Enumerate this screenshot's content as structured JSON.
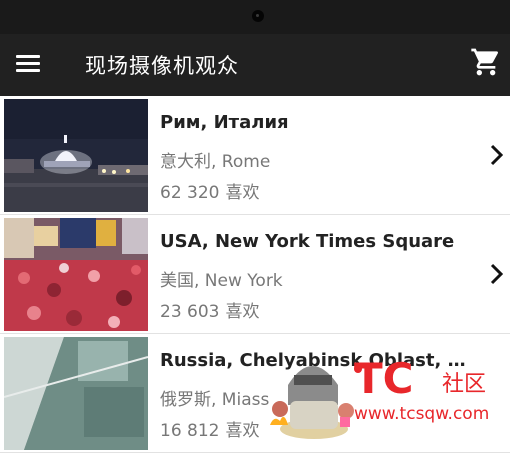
{
  "app_bar": {
    "title": "现场摄像机观众"
  },
  "icons": {
    "menu": "hamburger-menu-icon",
    "cart": "shopping-cart-icon",
    "chevron": "chevron-right-icon"
  },
  "webcams": [
    {
      "title": "Рим, Италия",
      "subtitle": "意大利, Rome",
      "likes": "62 320",
      "likes_label": "喜欢"
    },
    {
      "title": "USA, New York Times Square",
      "subtitle": "美国, New York",
      "likes": "23 603",
      "likes_label": "喜欢"
    },
    {
      "title": "Russia, Chelyabinsk Oblast, Mias...",
      "subtitle": "俄罗斯, Miass",
      "likes": "16 812",
      "likes_label": "喜欢"
    }
  ],
  "watermark": {
    "brand": "TC",
    "badge": "社区",
    "url": "www.tcsqw.com"
  },
  "colors": {
    "app_bar": "#212121",
    "status_bar": "#1a1a1a",
    "watermark_red": "#e8272b"
  }
}
